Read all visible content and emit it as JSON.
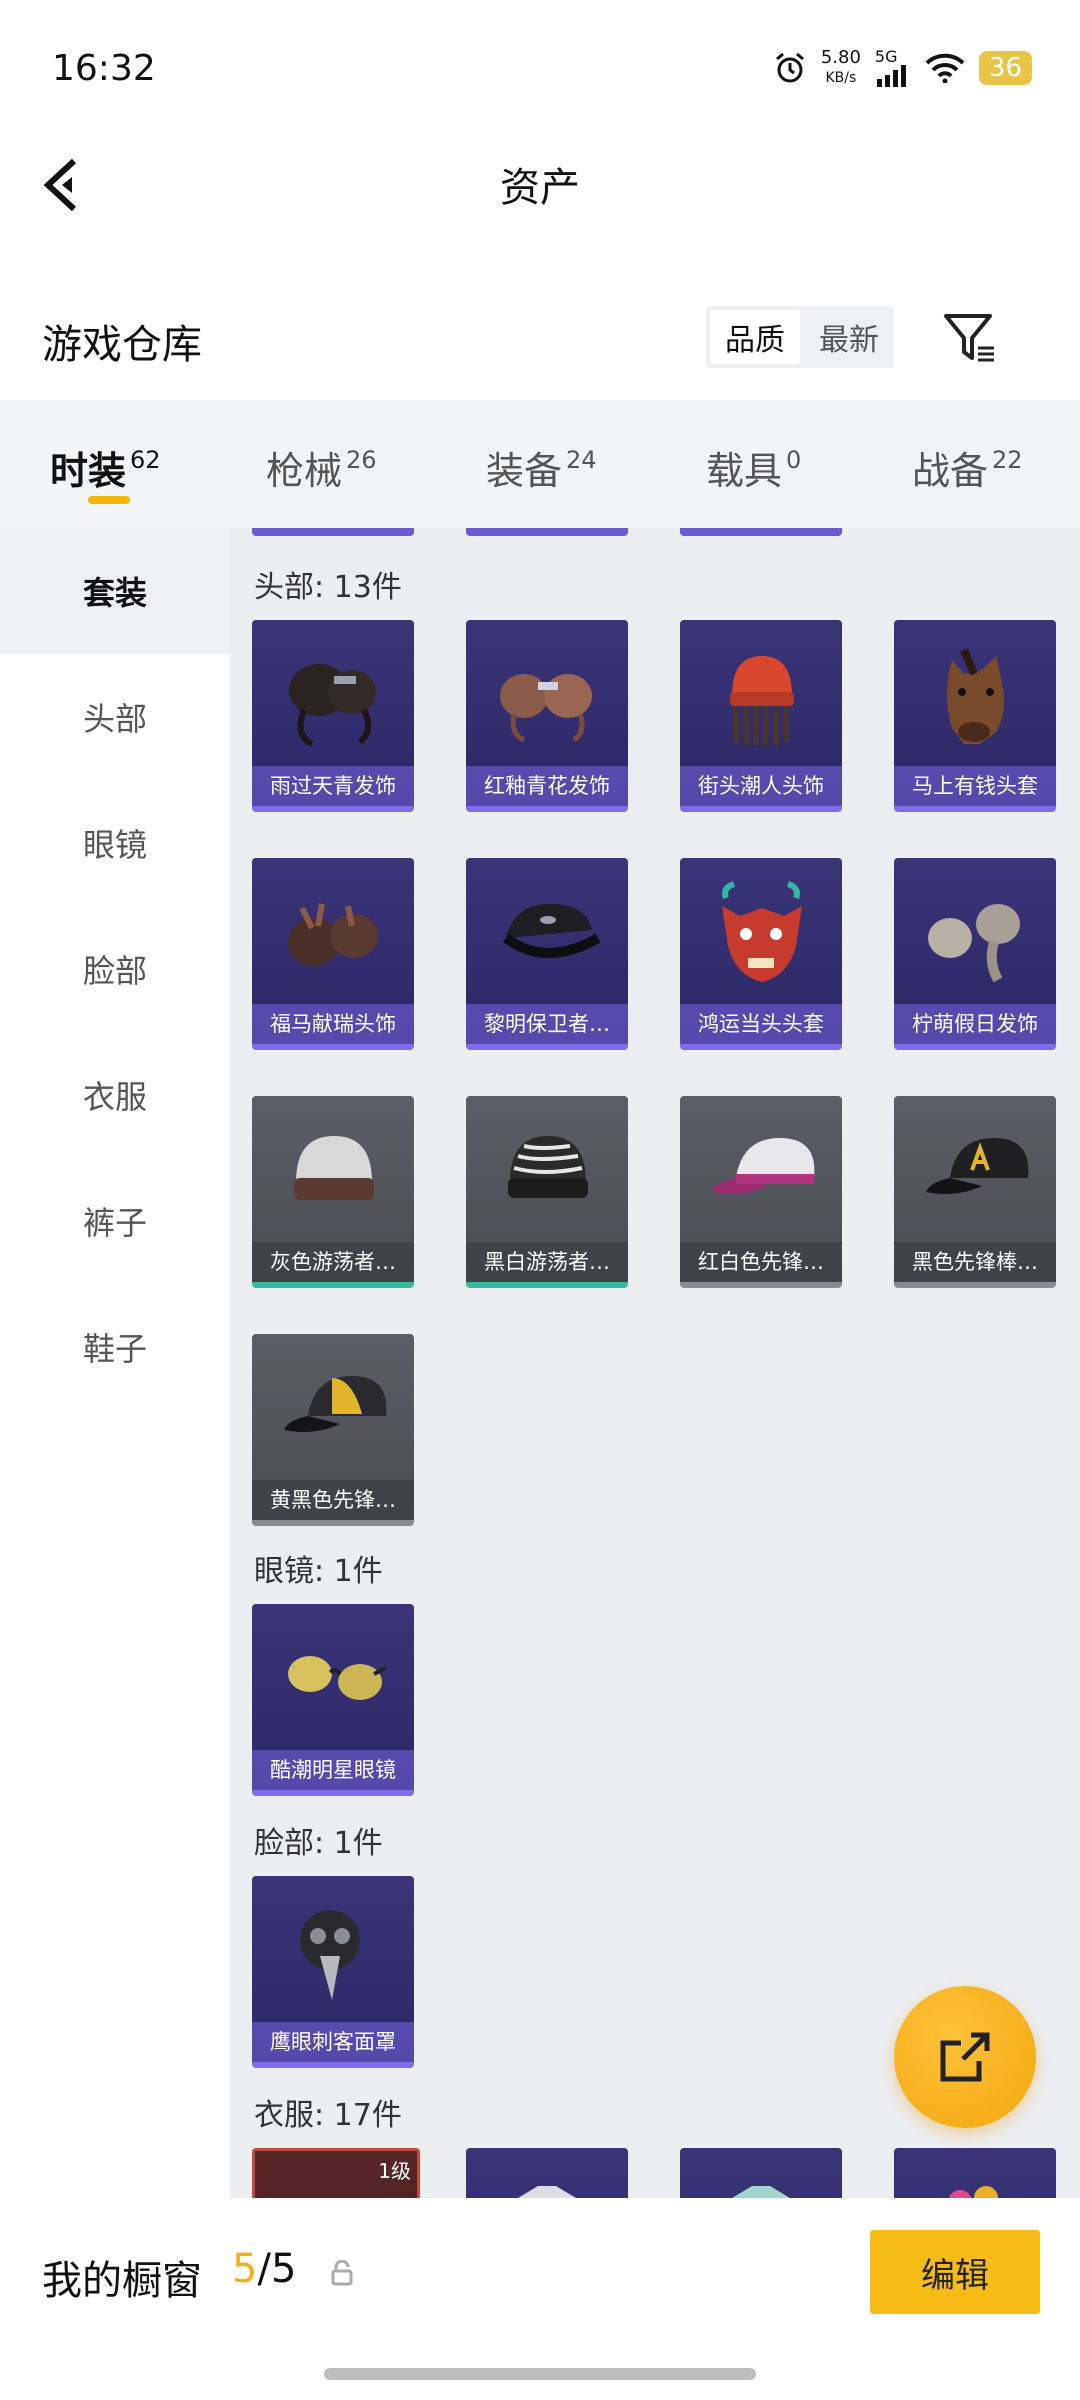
{
  "status_bar": {
    "time": "16:32",
    "net_speed_value": "5.80",
    "net_speed_unit": "KB/s",
    "network": "5G",
    "battery": "36"
  },
  "nav": {
    "title": "资产"
  },
  "section": {
    "title": "游戏仓库",
    "sort_options": [
      "品质",
      "最新"
    ],
    "active_sort": "品质"
  },
  "tabs": [
    {
      "label": "时装",
      "count": "62"
    },
    {
      "label": "枪械",
      "count": "26"
    },
    {
      "label": "装备",
      "count": "24"
    },
    {
      "label": "载具",
      "count": "0"
    },
    {
      "label": "战备",
      "count": "22"
    }
  ],
  "active_tab": "时装",
  "sidebar": {
    "items": [
      "套装",
      "头部",
      "眼镜",
      "脸部",
      "衣服",
      "裤子",
      "鞋子"
    ],
    "active": "套装"
  },
  "groups": [
    {
      "label": "头部: 13件",
      "items": [
        "雨过天青发饰",
        "红釉青花发饰",
        "街头潮人头饰",
        "马上有钱头套",
        "福马献瑞头饰",
        "黎明保卫者…",
        "鸿运当头头套",
        "柠萌假日发饰",
        "灰色游荡者…",
        "黑白游荡者…",
        "红白色先锋…",
        "黑色先锋棒…",
        "黄黑色先锋…"
      ]
    },
    {
      "label": "眼镜: 1件",
      "items": [
        "酷潮明星眼镜"
      ]
    },
    {
      "label": "脸部: 1件",
      "items": [
        "鹰眼刺客面罩"
      ]
    },
    {
      "label": "衣服: 17件",
      "first_item_badge": "1级"
    }
  ],
  "showcase": {
    "label": "我的橱窗",
    "current": "5",
    "sep": "/",
    "total": "5",
    "edit_label": "编辑"
  },
  "colors": {
    "accent": "#f7bd16",
    "purple_card": "#2f2b6e",
    "gray_card": "#50515a"
  }
}
